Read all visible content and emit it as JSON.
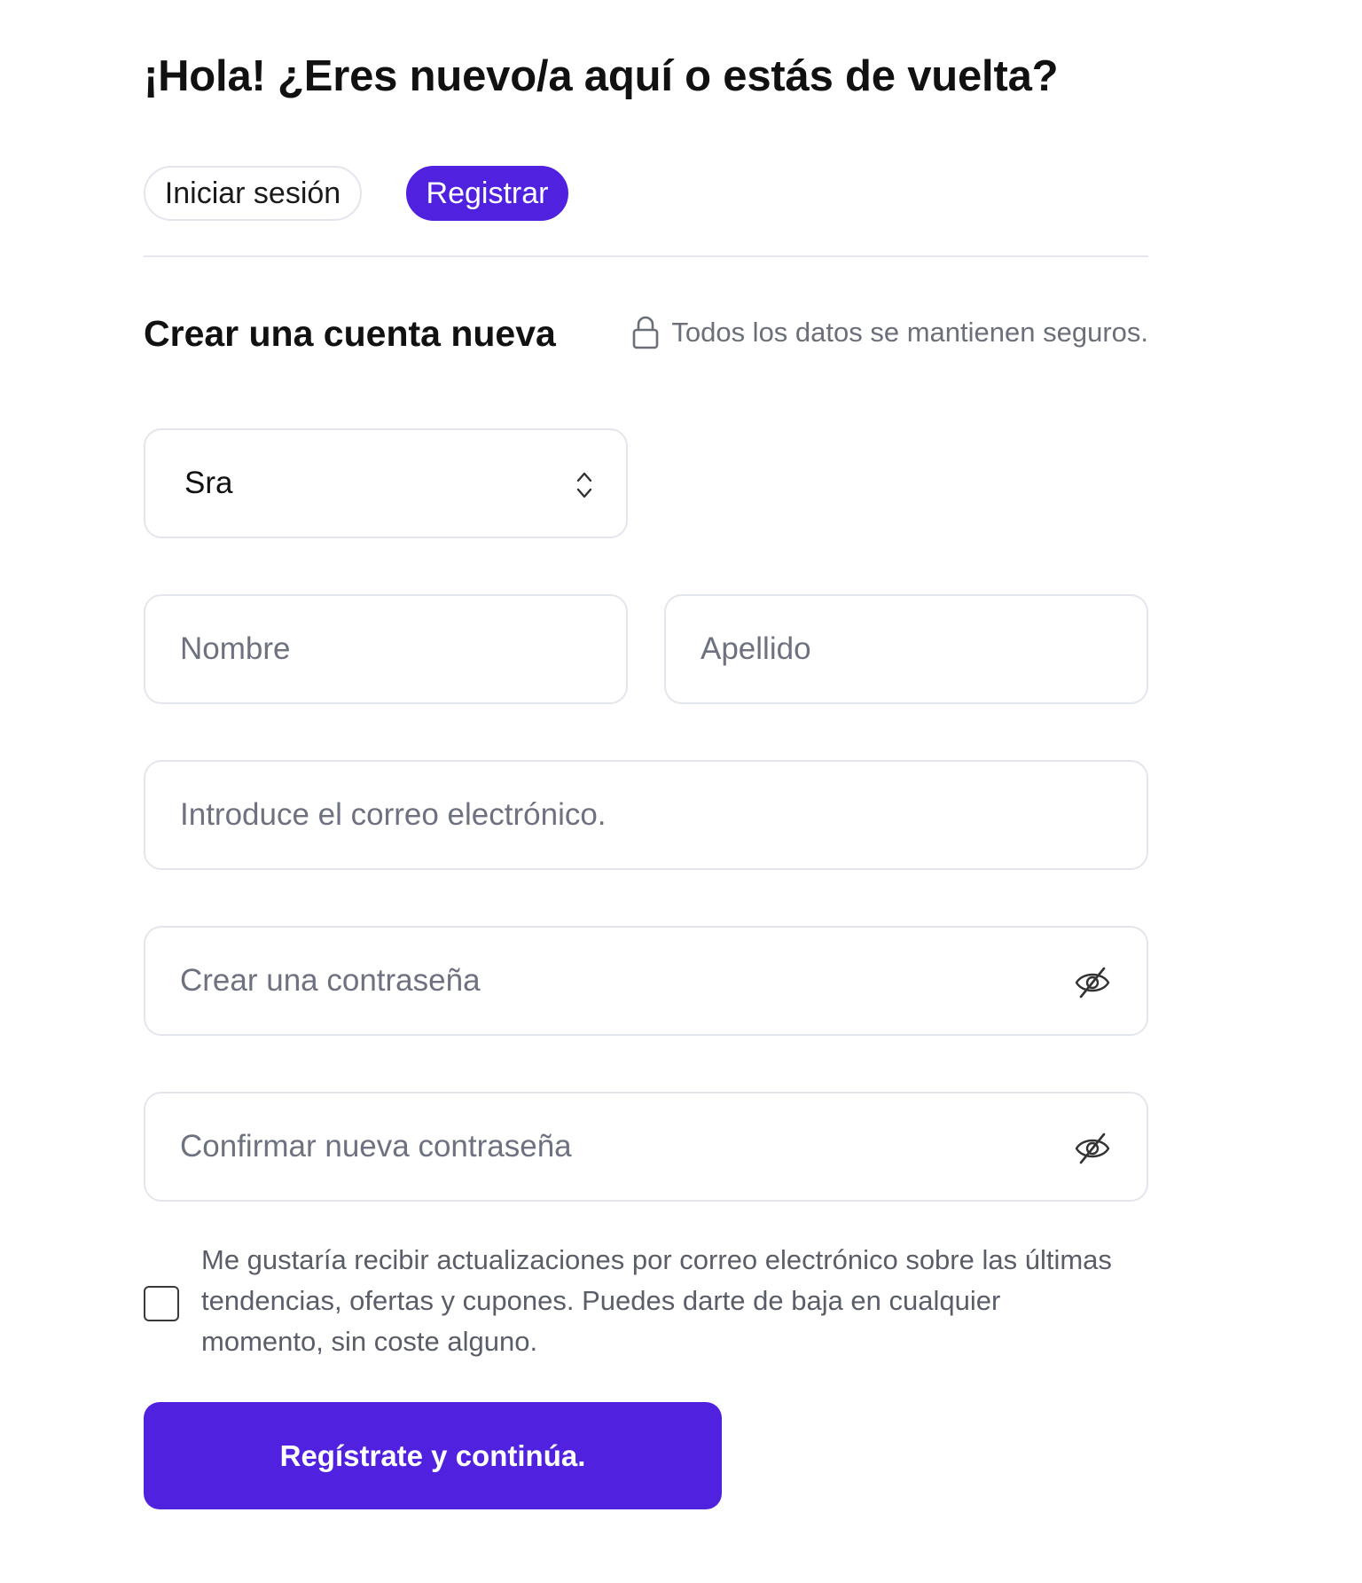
{
  "header": {
    "title": "¡Hola! ¿Eres nuevo/a aquí o estás de vuelta?"
  },
  "tabs": [
    {
      "label": "Iniciar sesión",
      "active": false
    },
    {
      "label": "Registrar",
      "active": true
    }
  ],
  "form": {
    "title": "Crear una cuenta nueva",
    "secure_note": "Todos los datos se mantienen seguros.",
    "secure_icon": "lock-icon",
    "salutation": {
      "value": "Sra",
      "icon": "chevron-up-down-icon"
    },
    "first_name": {
      "placeholder": "Nombre",
      "value": ""
    },
    "last_name": {
      "placeholder": "Apellido",
      "value": ""
    },
    "email": {
      "placeholder": "Introduce el correo electrónico.",
      "value": ""
    },
    "password": {
      "placeholder": "Crear una contraseña",
      "value": "",
      "icon": "eye-off-icon"
    },
    "confirm_password": {
      "placeholder": "Confirmar nueva contraseña",
      "value": "",
      "icon": "eye-off-icon"
    },
    "newsletter": {
      "checked": false,
      "label": "Me gustaría recibir actualizaciones por correo electrónico sobre las últimas tendencias, ofertas y cupones. Puedes darte de baja en cualquier momento, sin coste alguno."
    },
    "submit_label": "Regístrate y continúa."
  },
  "colors": {
    "accent": "#5121e0",
    "border": "#e4e6ee",
    "muted_text": "#6b6f7a"
  }
}
